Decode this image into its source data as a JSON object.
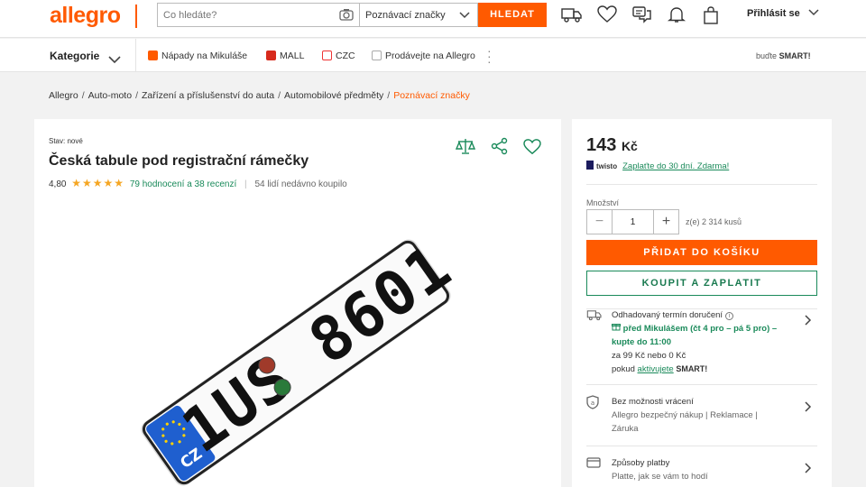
{
  "header": {
    "logo_text": "allegro",
    "search_placeholder": "Co hledáte?",
    "search_category": "Poznávací značky",
    "search_button": "HLEDAT",
    "login_label": "Přihlásit se",
    "icons": [
      "truck-icon",
      "heart-icon",
      "chat-icon",
      "bell-icon",
      "bag-icon"
    ]
  },
  "navbar": {
    "categories_label": "Kategorie",
    "links": [
      "Nápady na Mikuláše",
      "MALL",
      "CZC",
      "Prodávejte na Allegro"
    ],
    "smart_prefix": "buďte",
    "smart_word": "SMART!"
  },
  "breadcrumb": [
    "Allegro",
    "Auto-moto",
    "Zařízení a příslušenství do auta",
    "Automobilové předměty",
    "Poznávací značky"
  ],
  "product": {
    "condition_label": "Stav:",
    "condition_value": "nové",
    "title": "Česká tabule pod registrační rámečky",
    "rating": "4,80",
    "stars": 5,
    "reviews_text": "79 hodnocení a 38 recenzí",
    "recent_buyers": "54 lidí nedávno koupilo",
    "plate": {
      "text": "1US 8601",
      "country": "CZ"
    }
  },
  "buybox": {
    "price_value": "143",
    "price_currency": "Kč",
    "twisto_brand": "twisto",
    "twisto_text": "Zaplaťte do 30 dní. Zdarma!",
    "quantity_label": "Množství",
    "quantity_value": "1",
    "quantity_of": "z(e) 2 314 kusů",
    "add_to_cart": "PŘIDAT DO KOŠÍKU",
    "buy_now": "KOUPIT A ZAPLATIT",
    "delivery": {
      "title": "Odhadovaný termín doručení",
      "highlight": "před Mikulášem (čt 4 pro – pá 5 pro)",
      "order_by": " – kupte do 11:00",
      "price_line": "za 99 Kč nebo 0 Kč",
      "smart_prefix": "pokud",
      "smart_link": "aktivujete",
      "smart_word": "SMART!"
    },
    "returns": {
      "title": "Bez možnosti vrácení",
      "subtitle": "Allegro bezpečný nákup | Reklamace | Záruka"
    },
    "payment": {
      "title": "Způsoby platby",
      "subtitle": "Platte, jak se vám to hodí"
    }
  },
  "colors": {
    "brand": "#ff5a00",
    "green": "#1a8a5a",
    "star": "#f5a623"
  }
}
